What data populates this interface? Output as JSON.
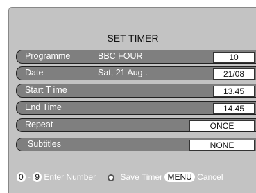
{
  "screen": {
    "title": "SET TIMER"
  },
  "rows": [
    {
      "label": "Programme",
      "info": "BBC FOUR",
      "value": "10"
    },
    {
      "label": "Date",
      "info": "Sat, 21 Aug .",
      "value": "21/08"
    },
    {
      "label": "Start T ime",
      "info": "",
      "value": "13.45"
    },
    {
      "label": "End Time",
      "info": "",
      "value": "14.45"
    },
    {
      "label": "Repeat",
      "info": "",
      "value": "ONCE"
    },
    {
      "label": "Subtitles",
      "info": "",
      "value": "NONE"
    }
  ],
  "footer": {
    "key_from": "0",
    "key_sep": "-",
    "key_to": "9",
    "enter_label": "Enter Number",
    "save_label": "Save Timer",
    "menu_key": "MENU",
    "cancel_label": "Cancel"
  }
}
